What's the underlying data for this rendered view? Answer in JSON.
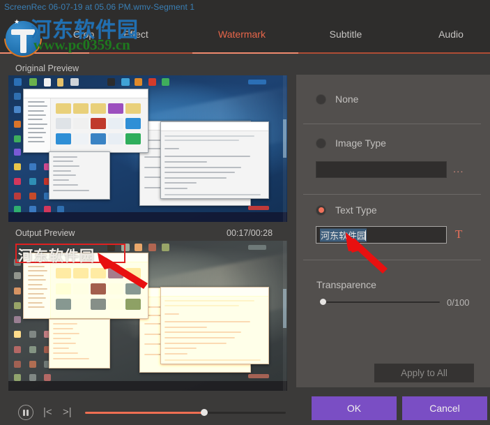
{
  "window": {
    "title": "ScreenRec 06-07-19 at 05.06 PM.wmv-Segment 1"
  },
  "tabs": [
    {
      "label": "Crop",
      "active": false
    },
    {
      "label": "Effect",
      "active": false
    },
    {
      "label": "Watermark",
      "active": true
    },
    {
      "label": "Subtitle",
      "active": false
    },
    {
      "label": "Audio",
      "active": false
    }
  ],
  "preview": {
    "original_label": "Original Preview",
    "output_label": "Output Preview",
    "timestamp": "00:17/00:28",
    "watermark_text_on_video": "河东软件园"
  },
  "panel": {
    "none": {
      "label": "None",
      "selected": false
    },
    "image_type": {
      "label": "Image Type",
      "selected": false,
      "path_value": "",
      "browse_label": "..."
    },
    "text_type": {
      "label": "Text Type",
      "selected": true,
      "text_value": "河东软件园",
      "font_icon": "T"
    },
    "transparence": {
      "label": "Transparence",
      "value": 0,
      "max": 100,
      "display": "0/100"
    },
    "apply_to_all_label": "Apply to All"
  },
  "playback": {
    "pause_icon": "pause-icon",
    "prev_icon": "previous-frame-icon",
    "next_icon": "next-frame-icon",
    "progress_percent": 61
  },
  "footer": {
    "ok_label": "OK",
    "cancel_label": "Cancel"
  },
  "site_watermark": {
    "name_cn": "河东软件园",
    "url": "www.pc0359.cn",
    "logo_icon": "site-logo-icon"
  },
  "colors": {
    "accent_orange": "#ef6f52",
    "active_tab": "#e8664a",
    "button_purple": "#7a4ec4",
    "panel_bg": "#524f4d",
    "window_bg": "#3b3a39",
    "titlebar_bg": "#2e2d2c",
    "title_text": "#3a7fb5"
  }
}
